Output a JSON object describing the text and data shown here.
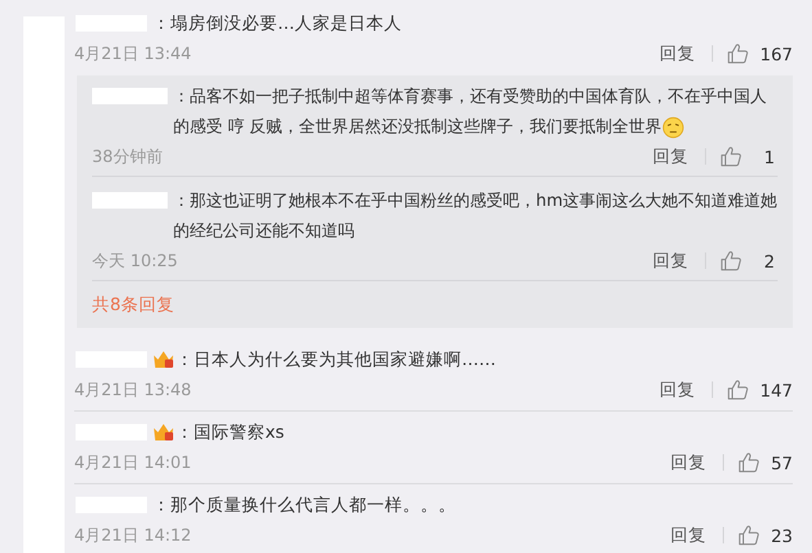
{
  "comments": [
    {
      "badge": false,
      "text": "：塌房倒没必要…人家是日本人",
      "time": "4月21日 13:44",
      "reply_label": "回复",
      "likes": "167",
      "replies": [
        {
          "text": "：品客不如一把子抵制中超等体育赛事，还有受赞助的中国体育队，不在乎中国人的感受 哼 反贼，全世界居然还没抵制这些牌子，我们要抵制全世界",
          "emoji": true,
          "time": "38分钟前",
          "reply_label": "回复",
          "likes": "1"
        },
        {
          "text": "：那这也证明了她根本不在乎中国粉丝的感受吧，hm这事闹这么大她不知道难道她的经纪公司还能不知道吗",
          "emoji": false,
          "time": "今天 10:25",
          "reply_label": "回复",
          "likes": "2"
        }
      ],
      "more_replies": "共8条回复"
    },
    {
      "badge": true,
      "text": "：日本人为什么要为其他国家避嫌啊……",
      "time": "4月21日 13:48",
      "reply_label": "回复",
      "likes": "147"
    },
    {
      "badge": true,
      "text": "：国际警察xs",
      "time": "4月21日 14:01",
      "reply_label": "回复",
      "likes": "57"
    },
    {
      "badge": false,
      "text": "：那个质量换什么代言人都一样。。。",
      "time": "4月21日 14:12",
      "reply_label": "回复",
      "likes": "23"
    }
  ]
}
